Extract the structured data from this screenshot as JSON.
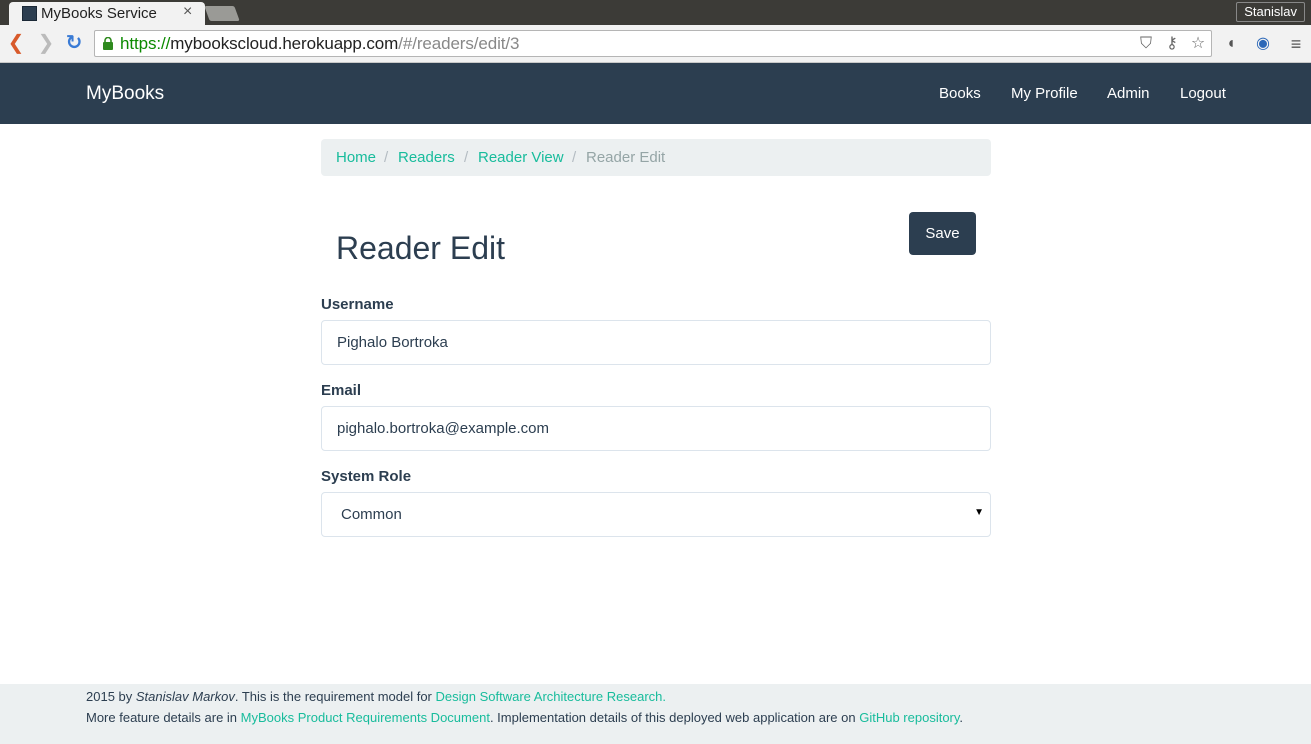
{
  "browser": {
    "tab_title": "MyBooks Service",
    "profile_name": "Stanislav",
    "url_scheme": "https://",
    "url_host": "mybookscloud.herokuapp.com",
    "url_path": "/#/readers/edit/3"
  },
  "navbar": {
    "brand": "MyBooks",
    "links": [
      "Books",
      "My Profile",
      "Admin",
      "Logout"
    ],
    "background": "#2c3e50"
  },
  "breadcrumb": {
    "items": [
      "Home",
      "Readers",
      "Reader View"
    ],
    "separator": "/",
    "active": "Reader Edit"
  },
  "form": {
    "title": "Reader Edit",
    "save_label": "Save",
    "username_label": "Username",
    "username_value": "Pighalo Bortroka",
    "email_label": "Email",
    "email_value": "pighalo.bortroka@example.com",
    "role_label": "System Role",
    "role_value": "Common"
  },
  "footer": {
    "year_by": "2015 by",
    "author": "Stanislav Markov",
    "line1_text": ". This is the requirement model for",
    "line1_link": "Design Software Architecture Research.",
    "line2_prefix": "More feature details are in",
    "line2_link1": "MyBooks Product Requirements Document",
    "line2_mid": ". Implementation details of this deployed web application are on",
    "line2_link2": "GitHub repository",
    "line2_end": "."
  },
  "colors": {
    "accent": "#18bc9c",
    "primary": "#2c3e50",
    "muted": "#95a5a6",
    "light_bg": "#ecf0f1"
  }
}
